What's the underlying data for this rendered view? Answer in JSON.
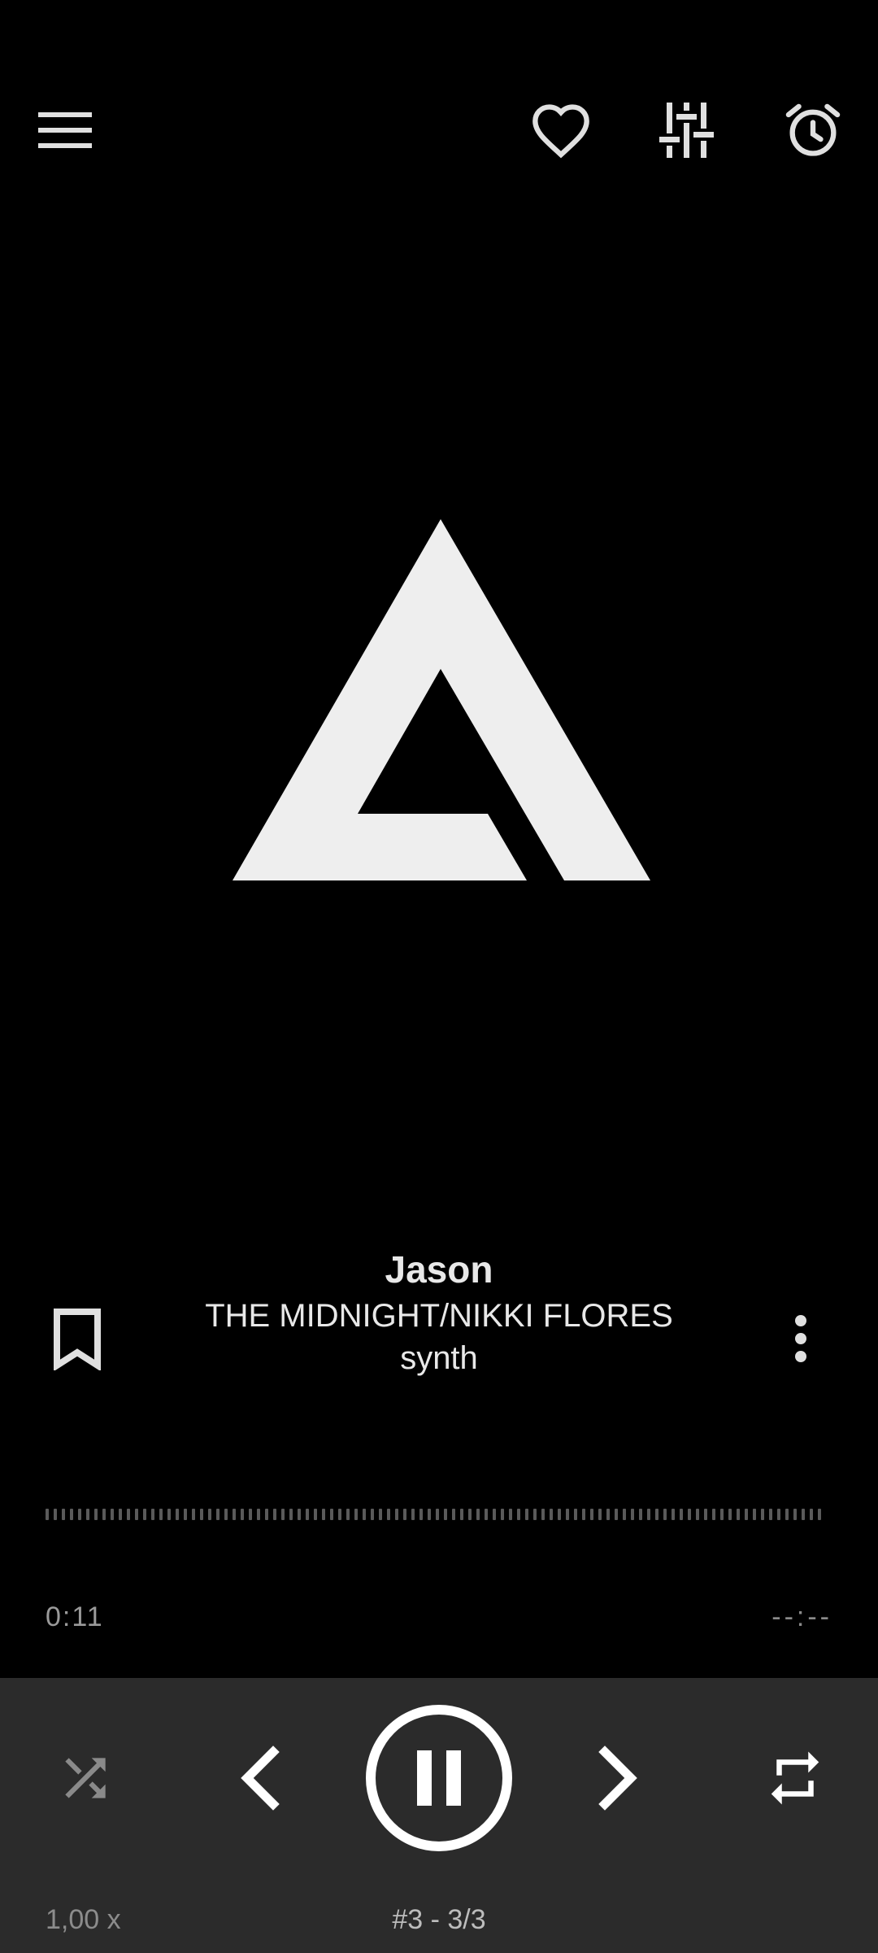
{
  "colors": {
    "background": "#000000",
    "panel": "#2b2b2b",
    "icon": "#e0e0e0",
    "icon_dim": "#8a8a8a",
    "logo": "#eeeeee"
  },
  "top_bar": {
    "menu_icon": "hamburger-menu-icon",
    "favorite_icon": "heart-outline-icon",
    "equalizer_icon": "equalizer-sliders-icon",
    "sleep_timer_icon": "alarm-clock-icon"
  },
  "album_art": {
    "icon": "app-logo-triangle"
  },
  "track": {
    "title": "Jason",
    "artist": "THE MIDNIGHT/NIKKI FLORES",
    "genre": "synth"
  },
  "track_actions": {
    "bookmark_icon": "bookmark-outline-icon",
    "more_icon": "more-vertical-icon"
  },
  "progress": {
    "elapsed": "0:11",
    "remaining": "--:--"
  },
  "controls": {
    "shuffle_icon": "shuffle-icon",
    "previous_icon": "chevron-left-icon",
    "play_pause_icon": "pause-circle-icon",
    "next_icon": "chevron-right-icon",
    "repeat_icon": "repeat-icon"
  },
  "footer": {
    "speed": "1,00 x",
    "queue_position": "#3 - 3/3"
  }
}
